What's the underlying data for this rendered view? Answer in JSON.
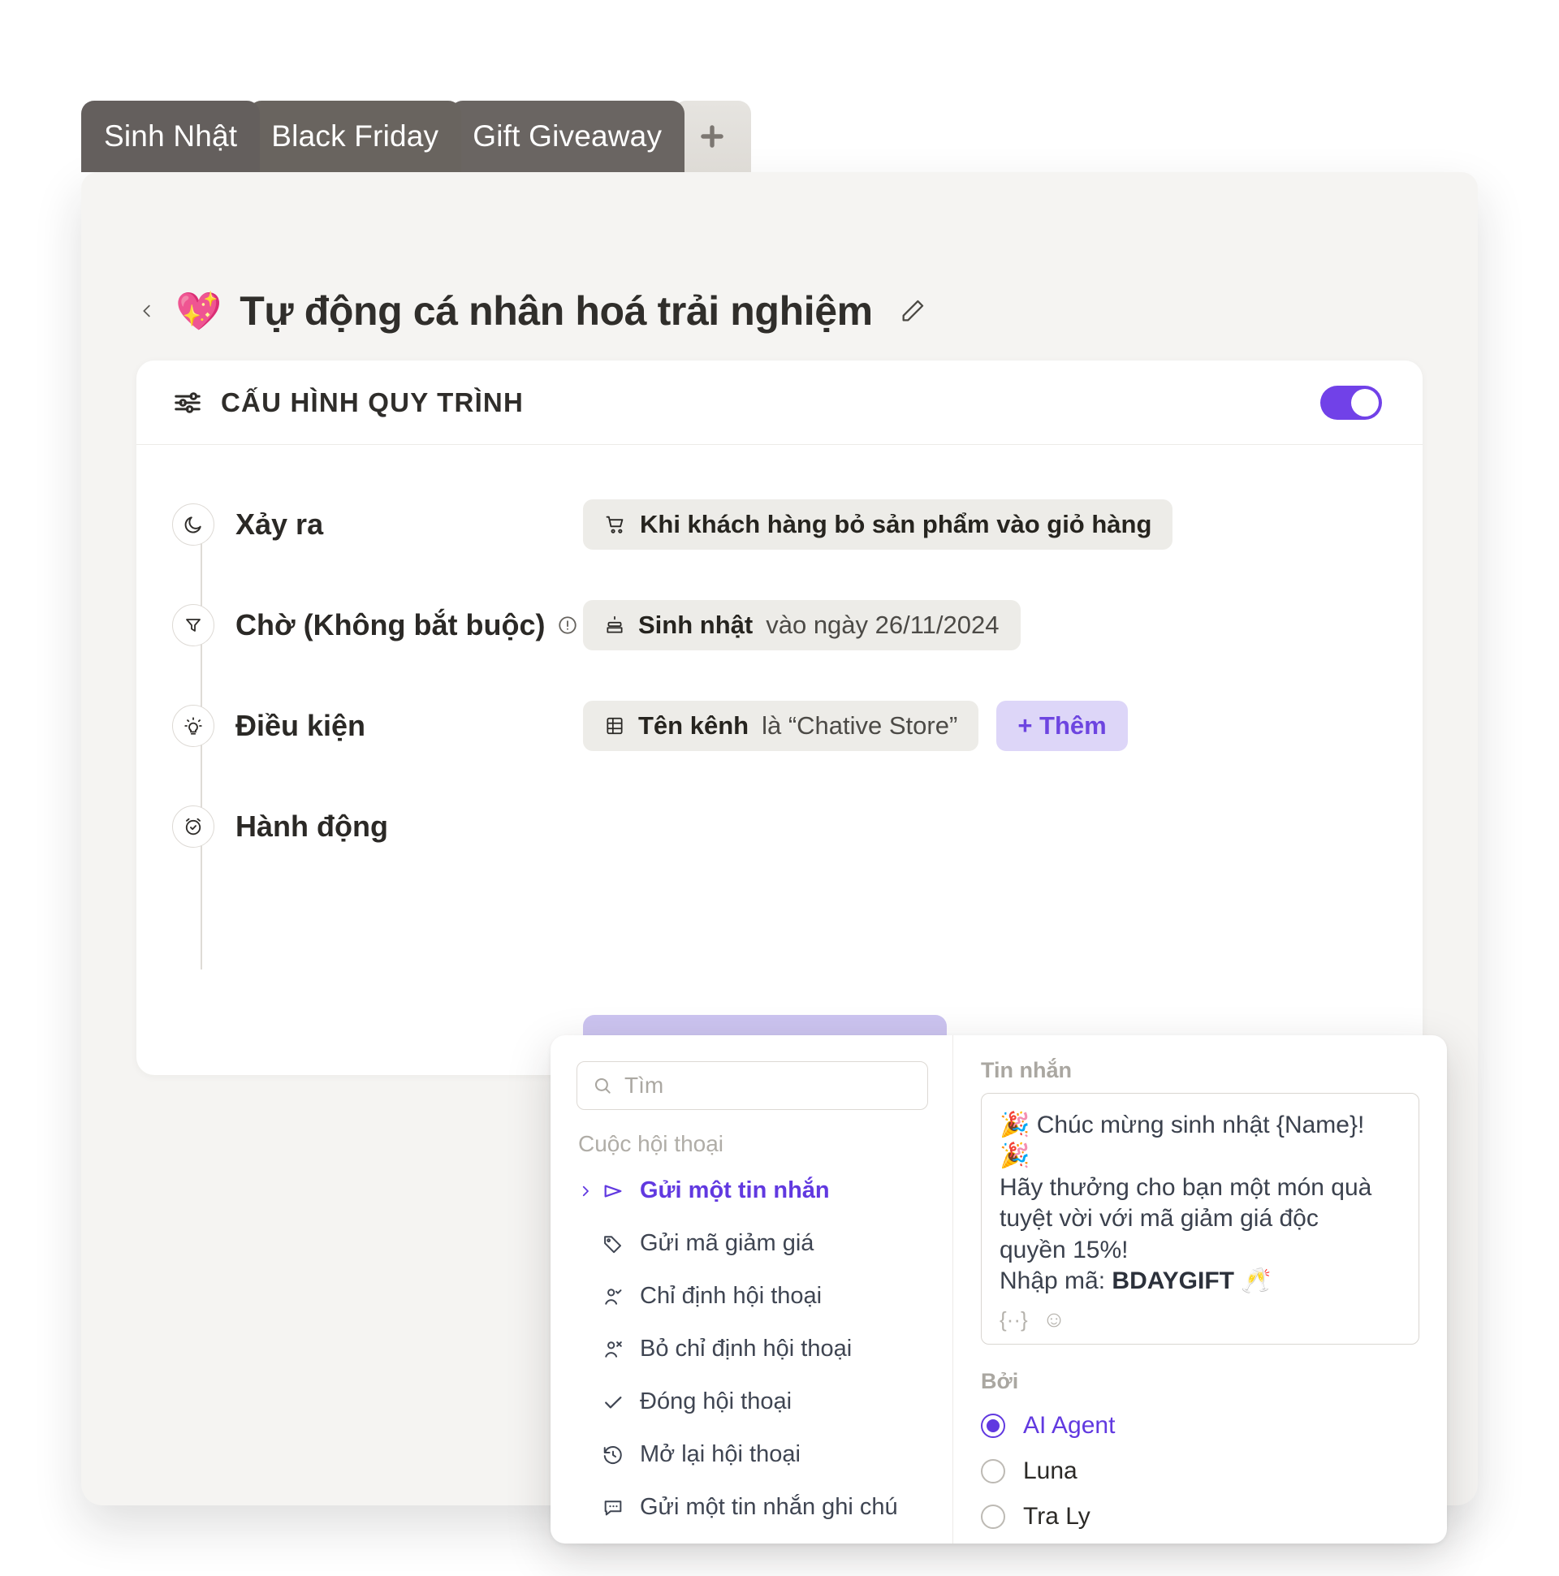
{
  "tabs": [
    {
      "label": "Sinh Nhật"
    },
    {
      "label": "Black Friday"
    },
    {
      "label": "Gift Giveaway"
    }
  ],
  "tab_add_icon": "plus-icon",
  "header": {
    "back_icon": "chevron-left-icon",
    "emoji": "💖",
    "title": "Tự động cá nhân hoá trải nghiệm",
    "edit_icon": "pencil-icon"
  },
  "card": {
    "icon": "sliders-icon",
    "title": "CẤU HÌNH QUY TRÌNH",
    "toggle_on": true,
    "toggle_color": "#7141e8"
  },
  "steps": [
    {
      "icon": "moon-icon",
      "label": "Xảy ra",
      "has_info": false,
      "chip_icon": "cart-icon",
      "chip_bold": "Khi khách hàng bỏ sản phẩm vào giỏ hàng",
      "chip_rest": "",
      "add_label": ""
    },
    {
      "icon": "funnel-icon",
      "label": "Chờ (Không bắt buộc)",
      "has_info": true,
      "info_icon": "info-icon",
      "chip_icon": "cake-icon",
      "chip_bold": "Sinh nhật",
      "chip_rest": " vào ngày 26/11/2024",
      "add_label": ""
    },
    {
      "icon": "bulb-icon",
      "label": "Điều kiện",
      "has_info": false,
      "chip_icon": "table-icon",
      "chip_bold": "Tên kênh",
      "chip_rest": " là “Chative Store”",
      "add_label": "+ Thêm"
    },
    {
      "icon": "alarm-check-icon",
      "label": "Hành động",
      "has_info": false,
      "chip_icon": "",
      "chip_bold": "",
      "chip_rest": "",
      "add_label": ""
    }
  ],
  "popover": {
    "search": {
      "icon": "search-icon",
      "placeholder": "Tìm",
      "value": ""
    },
    "group_label": "Cuộc hội thoại",
    "items": [
      {
        "label": "Gửi một tin nhắn",
        "icon": "send-icon",
        "active": true,
        "caret": "chevron-right-icon"
      },
      {
        "label": "Gửi mã giảm giá",
        "icon": "tag-icon",
        "active": false
      },
      {
        "label": "Chỉ định hội thoại",
        "icon": "user-check-icon",
        "active": false
      },
      {
        "label": "Bỏ chỉ định hội thoại",
        "icon": "user-x-icon",
        "active": false
      },
      {
        "label": "Đóng hội thoại",
        "icon": "check-icon",
        "active": false
      },
      {
        "label": "Mở lại hội thoại",
        "icon": "history-icon",
        "active": false
      },
      {
        "label": "Gửi một tin nhắn ghi chú",
        "icon": "note-chat-icon",
        "active": false
      }
    ],
    "message_label": "Tin nhắn",
    "message_lines": [
      "🎉 Chúc mừng sinh nhật {Name}! 🎉",
      "Hãy thưởng cho bạn một món quà",
      "tuyệt vời với mã giảm giá độc",
      "quyền 15%!"
    ],
    "message_last_prefix": "Nhập mã: ",
    "message_last_bold": "BDAYGIFT",
    "message_last_suffix": " 🥂",
    "message_tools": [
      {
        "icon": "variable-icon",
        "glyph": "{··}"
      },
      {
        "icon": "emoji-icon",
        "glyph": "☺"
      }
    ],
    "by_label": "Bởi",
    "by_options": [
      {
        "label": "AI Agent",
        "selected": true
      },
      {
        "label": "Luna",
        "selected": false
      },
      {
        "label": "Tra Ly",
        "selected": false
      }
    ],
    "accent_color": "#6139e0"
  }
}
